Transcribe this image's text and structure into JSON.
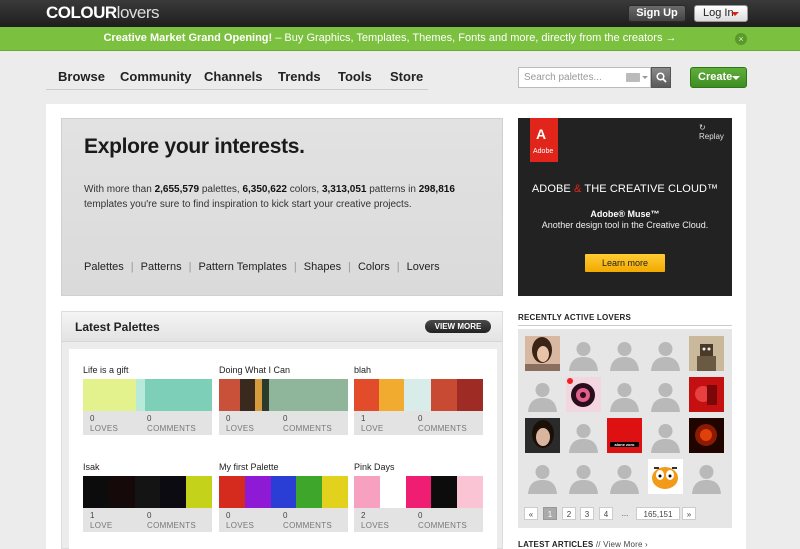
{
  "topbar": {
    "logo_main": "COLOUR",
    "logo_sub": "lovers",
    "signup": "Sign Up",
    "login": "Log In"
  },
  "promo": {
    "lead": "Creative Market Grand Opening!",
    "rest": " – Buy Graphics, Templates, Themes, Fonts and more, directly from the creators →",
    "close": "×"
  },
  "nav": {
    "items": [
      "Browse",
      "Community",
      "Channels",
      "Trends",
      "Tools",
      "Store"
    ]
  },
  "search": {
    "placeholder": "Search palettes..."
  },
  "create_label": "Create",
  "explore": {
    "title": "Explore your interests.",
    "desc": {
      "t1": "With more than ",
      "palettes": "2,655,579",
      "t2": " palettes, ",
      "colors": "6,350,622",
      "t3": " colors, ",
      "patterns": "3,313,051",
      "t4": " patterns in ",
      "templates": "298,816",
      "t5": " templates you're sure to find inspiration to kick start your creative projects."
    },
    "links": [
      "Palettes",
      "Patterns",
      "Pattern Templates",
      "Shapes",
      "Colors",
      "Lovers"
    ]
  },
  "ad": {
    "logo_letter": "A",
    "logo_text": "Adobe",
    "replay": "Replay",
    "headline_a": "ADOBE",
    "headline_amp": "&",
    "headline_b": "THE CREATIVE CLOUD™",
    "product": "Adobe® Muse™",
    "tagline": "Another design tool in the Creative Cloud.",
    "cta": "Learn more"
  },
  "latest_palettes": {
    "title": "Latest Palettes",
    "view_more": "VIEW MORE",
    "loves_label": "LOVES",
    "love_label": "LOVE",
    "comments_label": "COMMENTS",
    "items": [
      {
        "name": "Life is a gift",
        "loves": "0",
        "loves_label": "LOVES",
        "comments": "0",
        "swatches": [
          [
            "#e3f28c",
            0.41
          ],
          [
            "#b8eadc",
            0.07
          ],
          [
            "#7ecfb8",
            0.52
          ]
        ]
      },
      {
        "name": "Doing What I Can",
        "loves": "0",
        "loves_label": "LOVES",
        "comments": "0",
        "swatches": [
          [
            "#c9513a",
            0.16
          ],
          [
            "#3a2a1e",
            0.12
          ],
          [
            "#d79a3c",
            0.05
          ],
          [
            "#2b3a2a",
            0.06
          ],
          [
            "#8fb59a",
            0.61
          ]
        ]
      },
      {
        "name": "blah",
        "loves": "1",
        "loves_label": "LOVE",
        "comments": "0",
        "swatches": [
          [
            "#e34c2a",
            0.19
          ],
          [
            "#f1ac2f",
            0.2
          ],
          [
            "#d8ecea",
            0.21
          ],
          [
            "#c94a33",
            0.2
          ],
          [
            "#9f2c24",
            0.2
          ]
        ]
      },
      {
        "name": "Isak",
        "loves": "1",
        "loves_label": "LOVE",
        "comments": "0",
        "swatches": [
          [
            "#0c0c0c",
            0.2
          ],
          [
            "#16090a",
            0.2
          ],
          [
            "#141414",
            0.2
          ],
          [
            "#0d0b12",
            0.2
          ],
          [
            "#c4d21a",
            0.2
          ]
        ]
      },
      {
        "name": "My first Palette",
        "loves": "0",
        "loves_label": "LOVES",
        "comments": "0",
        "swatches": [
          [
            "#d52a1e",
            0.2
          ],
          [
            "#8e1ad6",
            0.2
          ],
          [
            "#2a3ed5",
            0.2
          ],
          [
            "#3ea62a",
            0.2
          ],
          [
            "#e2d21e",
            0.2
          ]
        ]
      },
      {
        "name": "Pink Days",
        "loves": "2",
        "loves_label": "LOVES",
        "comments": "0",
        "swatches": [
          [
            "#f7a0c0",
            0.2
          ],
          [
            "#ffffff",
            0.2
          ],
          [
            "#f01e72",
            0.2
          ],
          [
            "#0c0c0c",
            0.2
          ],
          [
            "#fbc4d4",
            0.2
          ]
        ]
      }
    ]
  },
  "lovers": {
    "title": "RECENTLY ACTIVE LOVERS",
    "avatars": [
      "photo-woman",
      "silhouette",
      "silhouette",
      "silhouette",
      "photo-robot",
      "silhouette",
      "photo-swirl",
      "silhouette",
      "silhouette",
      "photo-redart",
      "photo-woman2",
      "silhouette",
      "photo-redbox",
      "silhouette",
      "photo-fire",
      "silhouette",
      "silhouette",
      "silhouette",
      "photo-garfield",
      "silhouette"
    ],
    "redbox_text": "alone zoro",
    "pager": [
      "«",
      "1",
      "2",
      "3",
      "4",
      "...",
      "165,151",
      "»"
    ]
  },
  "latest_articles": {
    "title": "LATEST ARTICLES",
    "sep": " // ",
    "view_more": "View More ›"
  }
}
